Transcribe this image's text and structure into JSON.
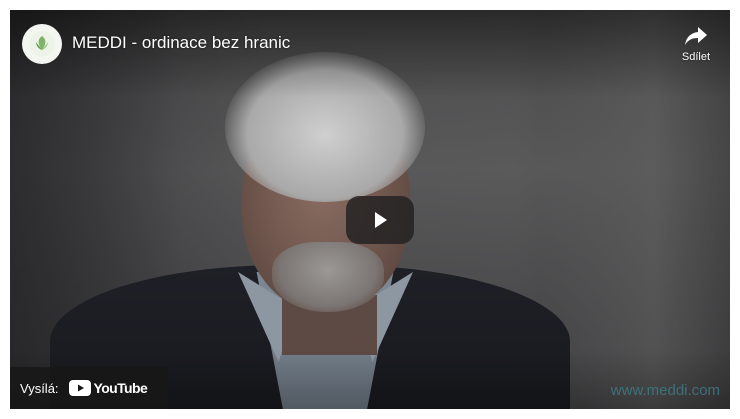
{
  "video": {
    "title": "MEDDI - ordinace bez hranic",
    "channel_logo_icon": "meddi-logo-icon"
  },
  "share": {
    "label": "Sdílet",
    "icon": "share-arrow-icon"
  },
  "player": {
    "play_icon": "play-icon",
    "play_button_color": "#212121"
  },
  "watch_on": {
    "label": "Vysílá:",
    "brand": "YouTube",
    "brand_color": "#ff0000"
  },
  "watermark": {
    "text": "www.meddi.com",
    "color": "#3e7a86"
  }
}
